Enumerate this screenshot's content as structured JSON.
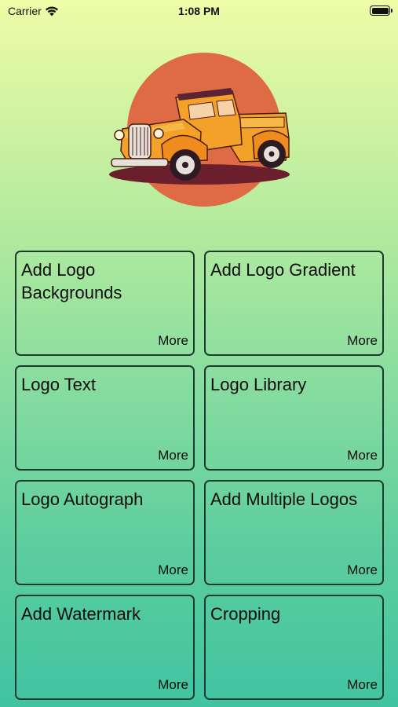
{
  "status_bar": {
    "carrier": "Carrier",
    "time": "1:08 PM",
    "icons": [
      "wifi-icon",
      "battery-icon"
    ]
  },
  "hero": {
    "image": "vintage-orange-pickup-truck-logo",
    "circle_color": "#df6b45",
    "truck_color": "#f4a12a"
  },
  "cards": [
    {
      "title": "Add Logo Backgrounds",
      "more": "More"
    },
    {
      "title": "Add Logo Gradient",
      "more": "More"
    },
    {
      "title": "Logo Text",
      "more": "More"
    },
    {
      "title": "Logo Library",
      "more": "More"
    },
    {
      "title": "Logo Autograph",
      "more": "More"
    },
    {
      "title": "Add Multiple Logos",
      "more": "More"
    },
    {
      "title": "Add Watermark",
      "more": "More"
    },
    {
      "title": "Cropping",
      "more": "More"
    }
  ],
  "colors": {
    "gradient_top": "#eefca7",
    "gradient_bottom": "#40c4a0",
    "card_border": "#1d3b30"
  }
}
